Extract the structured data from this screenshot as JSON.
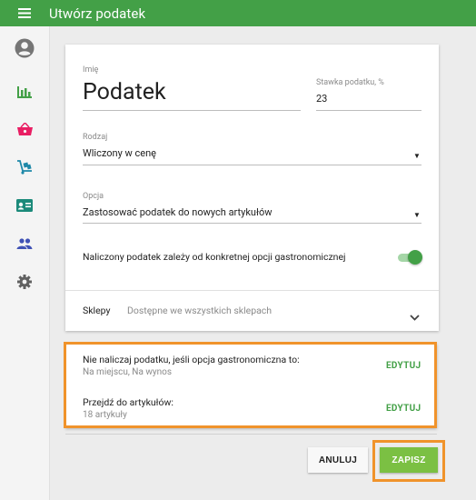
{
  "header": {
    "title": "Utwórz podatek"
  },
  "sidebar": {
    "items": [
      {
        "icon": "account-icon"
      },
      {
        "icon": "bar-chart-icon"
      },
      {
        "icon": "basket-icon"
      },
      {
        "icon": "cart-icon"
      },
      {
        "icon": "id-card-icon"
      },
      {
        "icon": "people-icon"
      },
      {
        "icon": "gear-icon"
      }
    ]
  },
  "form": {
    "name_label": "Imię",
    "name_value": "Podatek",
    "rate_label": "Stawka podatku, %",
    "rate_value": "23",
    "type_label": "Rodzaj",
    "type_value": "Wliczony w cenę",
    "option_label": "Opcja",
    "option_value": "Zastosować podatek do nowych artykułów",
    "toggle_label": "Naliczony podatek zależy od konkretnej opcji gastronomicznej",
    "toggle_on": true,
    "stores_label": "Sklepy",
    "stores_value": "Dostępne we wszystkich sklepach"
  },
  "exceptions": {
    "row1_title": "Nie naliczaj podatku, jeśli opcja gastronomiczna to:",
    "row1_sub": "Na miejscu, Na wynos",
    "row1_action": "EDYTUJ",
    "row2_title": "Przejdź do artykułów:",
    "row2_sub": "18 artykuły",
    "row2_action": "EDYTUJ"
  },
  "actions": {
    "cancel": "ANULUJ",
    "save": "ZAPISZ"
  },
  "colors": {
    "primary": "#43a047",
    "save_button": "#7bc043",
    "highlight": "#f0932b"
  }
}
